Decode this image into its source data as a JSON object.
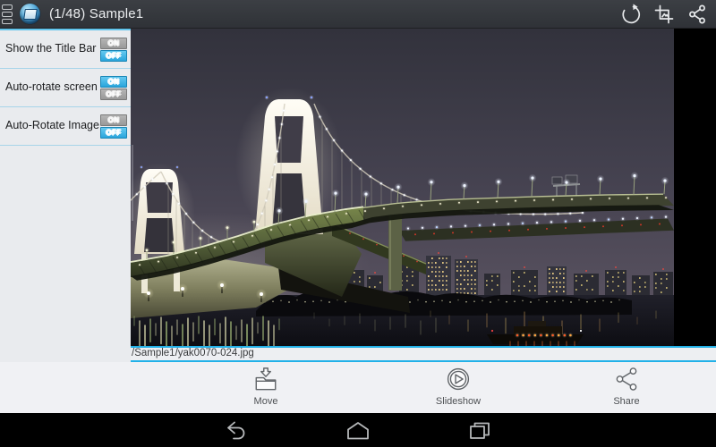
{
  "action_bar": {
    "title": "(1/48) Sample1"
  },
  "settings": {
    "on_label": "ON",
    "off_label": "OFF",
    "rows": [
      {
        "label": "Show the Title Bar",
        "state": "off"
      },
      {
        "label": "Auto-rotate screen",
        "state": "on"
      },
      {
        "label": "Auto-Rotate Image",
        "state": "off"
      }
    ]
  },
  "image_info": {
    "path_label": "/Sample1/yak0070-024.jpg"
  },
  "toolbar": {
    "buttons": [
      {
        "id": "move",
        "label": "Move"
      },
      {
        "id": "slideshow",
        "label": "Slideshow"
      },
      {
        "id": "share",
        "label": "Share"
      }
    ]
  },
  "nav_bar": {
    "buttons": [
      "back",
      "home",
      "recents"
    ]
  },
  "colors": {
    "accent_cyan": "#22b1e8",
    "toggle_on_blue": "#2aa5dc",
    "action_bar_bg": "#34373c",
    "panel_bg": "#e9ebee",
    "toolbar_bg": "#f0f1f4",
    "divider_blue": "#a7d4e9"
  }
}
